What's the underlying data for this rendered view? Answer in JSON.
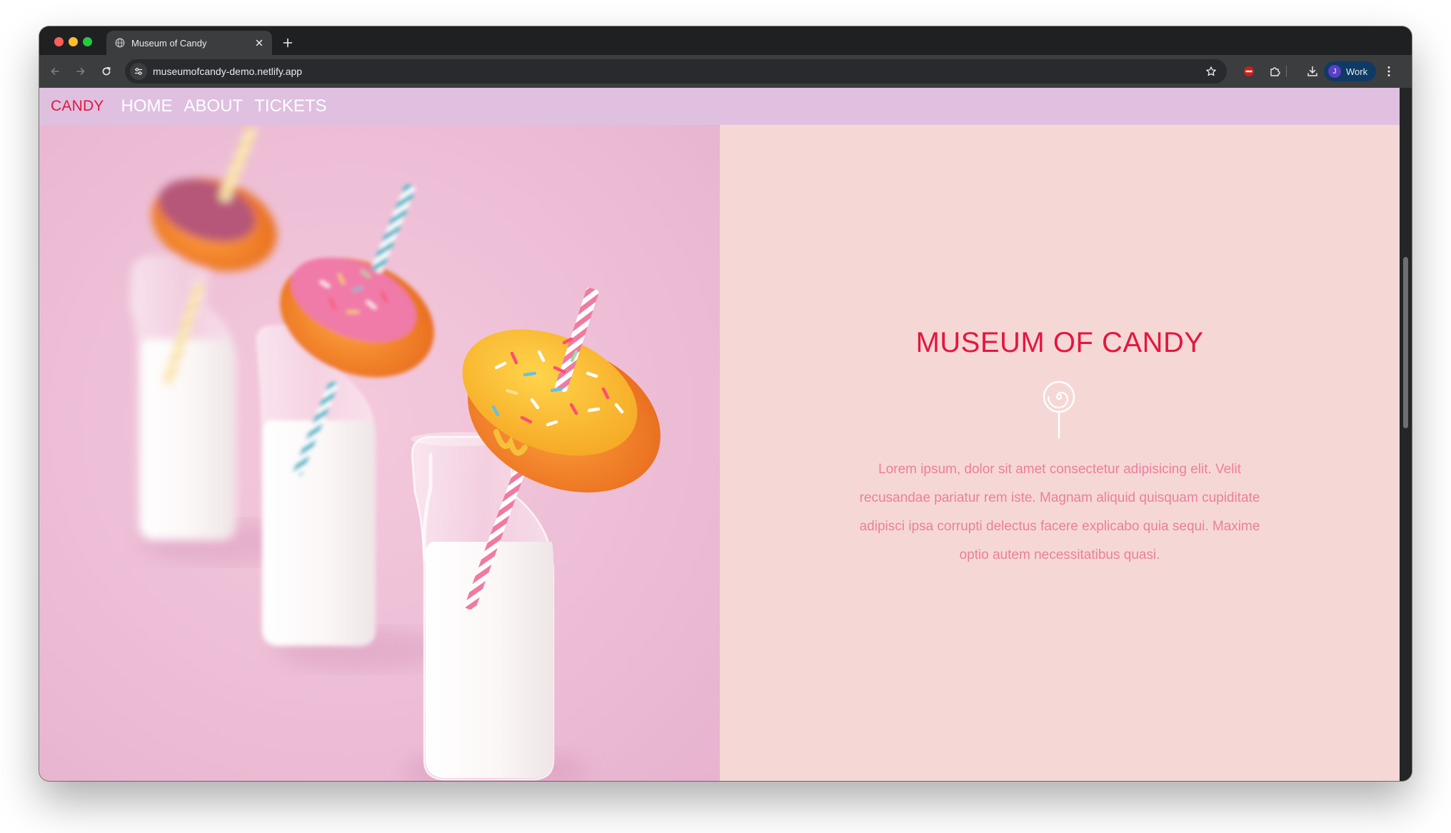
{
  "browser": {
    "tab": {
      "title": "Museum of Candy",
      "favicon": "globe-icon"
    },
    "url": "museumofcandy-demo.netlify.app",
    "profile": {
      "initial": "J",
      "name": "Work"
    },
    "icons": [
      "back-icon",
      "forward-icon",
      "reload-icon",
      "site-info-icon",
      "bookmark-star-icon",
      "extension-blocker-icon",
      "extensions-puzzle-icon",
      "download-icon",
      "menu-kebab-icon"
    ]
  },
  "site": {
    "brand": "CANDY",
    "nav": {
      "home": "HOME",
      "about": "ABOUT",
      "tickets": "TICKETS"
    },
    "hero": {
      "title": "MUSEUM OF CANDY",
      "icon": "lollipop-icon",
      "description": "Lorem ipsum, dolor sit amet consectetur adipisicing elit. Velit recusandae pariatur rem iste. Magnam aliquid quisquam cupiditate adipisci ipsa corrupti delectus facere explicabo quia sequi. Maxime optio autem necessitatibus quasi."
    }
  },
  "colors": {
    "accent": "#e5163e",
    "nav_bg": "#dfc0e0",
    "hero_panel_bg": "#f5d8d6",
    "body_text": "#ec7f9c",
    "image_bg": "#eec0d7"
  }
}
